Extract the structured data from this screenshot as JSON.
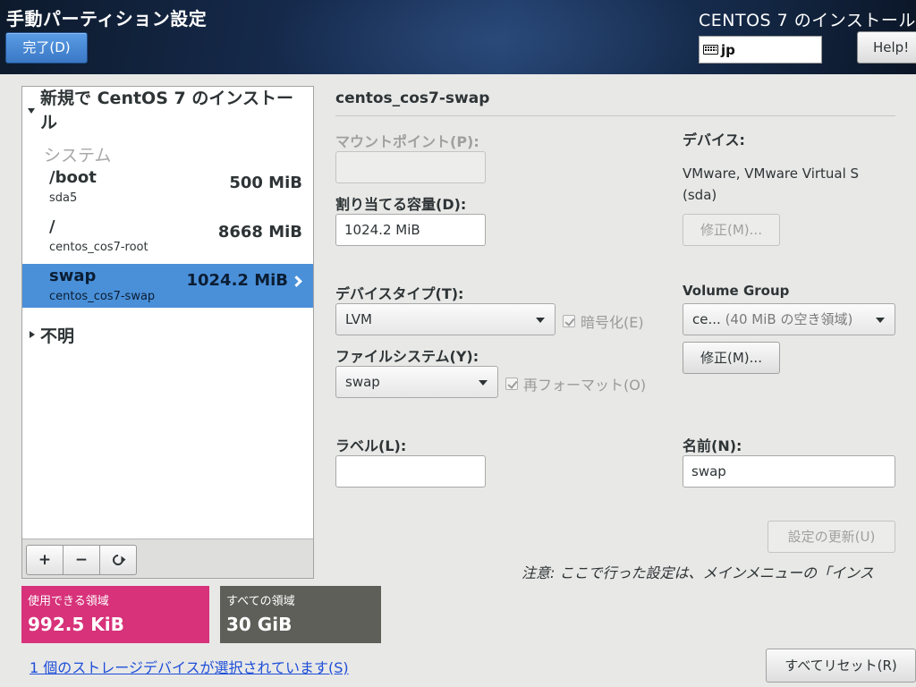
{
  "header": {
    "title": "手動パーティション設定",
    "done_label": "完了(D)",
    "install_title": "CENTOS 7 のインストール",
    "keyboard_layout": "jp",
    "help_label": "Help!"
  },
  "left_panel": {
    "new_install_title": "新規で CentOS 7 のインストール",
    "system_heading": "システム",
    "mount_points": [
      {
        "mount": "/boot",
        "device": "sda5",
        "size": "500 MiB",
        "selected": false
      },
      {
        "mount": "/",
        "device": "centos_cos7-root",
        "size": "8668 MiB",
        "selected": false
      },
      {
        "mount": "swap",
        "device": "centos_cos7-swap",
        "size": "1024.2 MiB",
        "selected": true
      }
    ],
    "unknown_label": "不明",
    "toolbar": {
      "add": "+",
      "remove": "−"
    }
  },
  "space": {
    "available_label": "使用できる領域",
    "available_value": "992.5 KiB",
    "total_label": "すべての領域",
    "total_value": "30 GiB"
  },
  "storage_link": "1 個のストレージデバイスが選択されています(S)",
  "details": {
    "title": "centos_cos7-swap",
    "mount_point_label": "マウントポイント(P):",
    "mount_point_value": "",
    "capacity_label": "割り当てる容量(D):",
    "capacity_value": "1024.2 MiB",
    "device_type_label": "デバイスタイプ(T):",
    "device_type_value": "LVM",
    "encrypt_label": "暗号化(E)",
    "filesystem_label": "ファイルシステム(Y):",
    "filesystem_value": "swap",
    "reformat_label": "再フォーマット(O)",
    "label_label": "ラベル(L):",
    "label_value": "",
    "devices_label": "デバイス:",
    "device_line1": "VMware, VMware Virtual S",
    "device_line2": "(sda)",
    "modify_disabled_label": "修正(M)...",
    "volume_group_label": "Volume Group",
    "volume_group_name": "ce...",
    "volume_group_free": "(40 MiB の空き領域)",
    "modify_label": "修正(M)...",
    "name_label": "名前(N):",
    "name_value": "swap",
    "update_label": "設定の更新(U)",
    "note": "注意: ここで行った設定は、メインメニューの「インス",
    "reset_all_label": "すべてリセット(R)"
  },
  "colors": {
    "selected_row": "#4a90d9",
    "available_space": "#d7327a",
    "total_space": "#5f5f59",
    "done_button": "#3a78c4"
  }
}
